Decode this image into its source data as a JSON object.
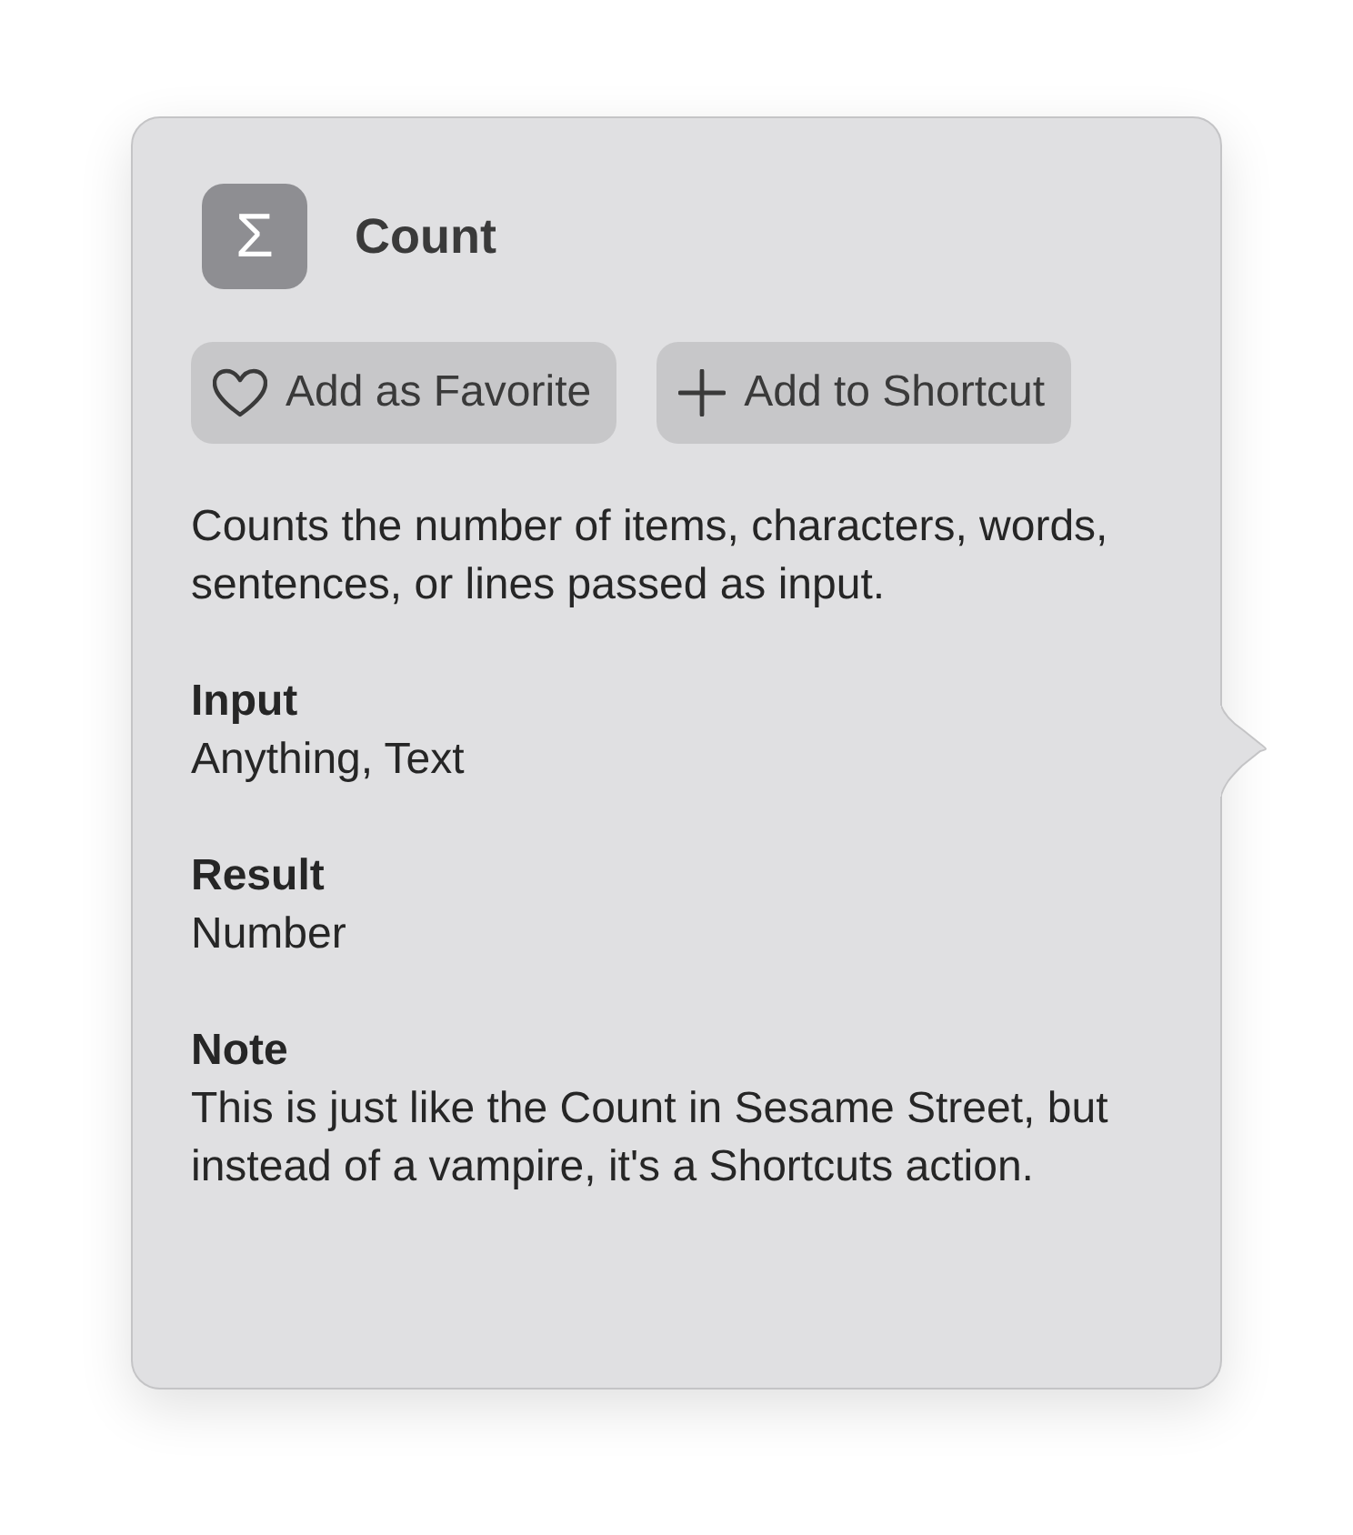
{
  "action": {
    "icon_glyph": "Σ",
    "title": "Count"
  },
  "buttons": [
    {
      "kind": "favorite",
      "label": "Add as Favorite"
    },
    {
      "kind": "add",
      "label": "Add to Shortcut"
    }
  ],
  "description": "Counts the number of items, characters, words, sentences, or lines passed as input.",
  "sections": [
    {
      "heading": "Input",
      "text": "Anything, Text"
    },
    {
      "heading": "Result",
      "text": "Number"
    },
    {
      "heading": "Note",
      "text": "This is just like the Count in Sesame Street, but instead of a vampire, it's a Shortcuts action."
    }
  ]
}
